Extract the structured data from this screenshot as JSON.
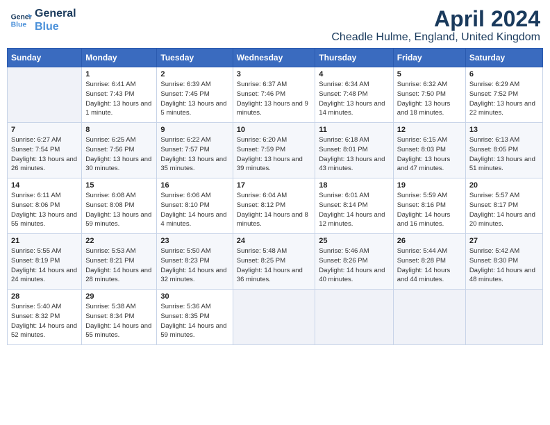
{
  "logo": {
    "line1": "General",
    "line2": "Blue"
  },
  "title": "April 2024",
  "subtitle": "Cheadle Hulme, England, United Kingdom",
  "days_of_week": [
    "Sunday",
    "Monday",
    "Tuesday",
    "Wednesday",
    "Thursday",
    "Friday",
    "Saturday"
  ],
  "weeks": [
    [
      {
        "num": "",
        "sunrise": "",
        "sunset": "",
        "daylight": ""
      },
      {
        "num": "1",
        "sunrise": "Sunrise: 6:41 AM",
        "sunset": "Sunset: 7:43 PM",
        "daylight": "Daylight: 13 hours and 1 minute."
      },
      {
        "num": "2",
        "sunrise": "Sunrise: 6:39 AM",
        "sunset": "Sunset: 7:45 PM",
        "daylight": "Daylight: 13 hours and 5 minutes."
      },
      {
        "num": "3",
        "sunrise": "Sunrise: 6:37 AM",
        "sunset": "Sunset: 7:46 PM",
        "daylight": "Daylight: 13 hours and 9 minutes."
      },
      {
        "num": "4",
        "sunrise": "Sunrise: 6:34 AM",
        "sunset": "Sunset: 7:48 PM",
        "daylight": "Daylight: 13 hours and 14 minutes."
      },
      {
        "num": "5",
        "sunrise": "Sunrise: 6:32 AM",
        "sunset": "Sunset: 7:50 PM",
        "daylight": "Daylight: 13 hours and 18 minutes."
      },
      {
        "num": "6",
        "sunrise": "Sunrise: 6:29 AM",
        "sunset": "Sunset: 7:52 PM",
        "daylight": "Daylight: 13 hours and 22 minutes."
      }
    ],
    [
      {
        "num": "7",
        "sunrise": "Sunrise: 6:27 AM",
        "sunset": "Sunset: 7:54 PM",
        "daylight": "Daylight: 13 hours and 26 minutes."
      },
      {
        "num": "8",
        "sunrise": "Sunrise: 6:25 AM",
        "sunset": "Sunset: 7:56 PM",
        "daylight": "Daylight: 13 hours and 30 minutes."
      },
      {
        "num": "9",
        "sunrise": "Sunrise: 6:22 AM",
        "sunset": "Sunset: 7:57 PM",
        "daylight": "Daylight: 13 hours and 35 minutes."
      },
      {
        "num": "10",
        "sunrise": "Sunrise: 6:20 AM",
        "sunset": "Sunset: 7:59 PM",
        "daylight": "Daylight: 13 hours and 39 minutes."
      },
      {
        "num": "11",
        "sunrise": "Sunrise: 6:18 AM",
        "sunset": "Sunset: 8:01 PM",
        "daylight": "Daylight: 13 hours and 43 minutes."
      },
      {
        "num": "12",
        "sunrise": "Sunrise: 6:15 AM",
        "sunset": "Sunset: 8:03 PM",
        "daylight": "Daylight: 13 hours and 47 minutes."
      },
      {
        "num": "13",
        "sunrise": "Sunrise: 6:13 AM",
        "sunset": "Sunset: 8:05 PM",
        "daylight": "Daylight: 13 hours and 51 minutes."
      }
    ],
    [
      {
        "num": "14",
        "sunrise": "Sunrise: 6:11 AM",
        "sunset": "Sunset: 8:06 PM",
        "daylight": "Daylight: 13 hours and 55 minutes."
      },
      {
        "num": "15",
        "sunrise": "Sunrise: 6:08 AM",
        "sunset": "Sunset: 8:08 PM",
        "daylight": "Daylight: 13 hours and 59 minutes."
      },
      {
        "num": "16",
        "sunrise": "Sunrise: 6:06 AM",
        "sunset": "Sunset: 8:10 PM",
        "daylight": "Daylight: 14 hours and 4 minutes."
      },
      {
        "num": "17",
        "sunrise": "Sunrise: 6:04 AM",
        "sunset": "Sunset: 8:12 PM",
        "daylight": "Daylight: 14 hours and 8 minutes."
      },
      {
        "num": "18",
        "sunrise": "Sunrise: 6:01 AM",
        "sunset": "Sunset: 8:14 PM",
        "daylight": "Daylight: 14 hours and 12 minutes."
      },
      {
        "num": "19",
        "sunrise": "Sunrise: 5:59 AM",
        "sunset": "Sunset: 8:16 PM",
        "daylight": "Daylight: 14 hours and 16 minutes."
      },
      {
        "num": "20",
        "sunrise": "Sunrise: 5:57 AM",
        "sunset": "Sunset: 8:17 PM",
        "daylight": "Daylight: 14 hours and 20 minutes."
      }
    ],
    [
      {
        "num": "21",
        "sunrise": "Sunrise: 5:55 AM",
        "sunset": "Sunset: 8:19 PM",
        "daylight": "Daylight: 14 hours and 24 minutes."
      },
      {
        "num": "22",
        "sunrise": "Sunrise: 5:53 AM",
        "sunset": "Sunset: 8:21 PM",
        "daylight": "Daylight: 14 hours and 28 minutes."
      },
      {
        "num": "23",
        "sunrise": "Sunrise: 5:50 AM",
        "sunset": "Sunset: 8:23 PM",
        "daylight": "Daylight: 14 hours and 32 minutes."
      },
      {
        "num": "24",
        "sunrise": "Sunrise: 5:48 AM",
        "sunset": "Sunset: 8:25 PM",
        "daylight": "Daylight: 14 hours and 36 minutes."
      },
      {
        "num": "25",
        "sunrise": "Sunrise: 5:46 AM",
        "sunset": "Sunset: 8:26 PM",
        "daylight": "Daylight: 14 hours and 40 minutes."
      },
      {
        "num": "26",
        "sunrise": "Sunrise: 5:44 AM",
        "sunset": "Sunset: 8:28 PM",
        "daylight": "Daylight: 14 hours and 44 minutes."
      },
      {
        "num": "27",
        "sunrise": "Sunrise: 5:42 AM",
        "sunset": "Sunset: 8:30 PM",
        "daylight": "Daylight: 14 hours and 48 minutes."
      }
    ],
    [
      {
        "num": "28",
        "sunrise": "Sunrise: 5:40 AM",
        "sunset": "Sunset: 8:32 PM",
        "daylight": "Daylight: 14 hours and 52 minutes."
      },
      {
        "num": "29",
        "sunrise": "Sunrise: 5:38 AM",
        "sunset": "Sunset: 8:34 PM",
        "daylight": "Daylight: 14 hours and 55 minutes."
      },
      {
        "num": "30",
        "sunrise": "Sunrise: 5:36 AM",
        "sunset": "Sunset: 8:35 PM",
        "daylight": "Daylight: 14 hours and 59 minutes."
      },
      {
        "num": "",
        "sunrise": "",
        "sunset": "",
        "daylight": ""
      },
      {
        "num": "",
        "sunrise": "",
        "sunset": "",
        "daylight": ""
      },
      {
        "num": "",
        "sunrise": "",
        "sunset": "",
        "daylight": ""
      },
      {
        "num": "",
        "sunrise": "",
        "sunset": "",
        "daylight": ""
      }
    ]
  ]
}
